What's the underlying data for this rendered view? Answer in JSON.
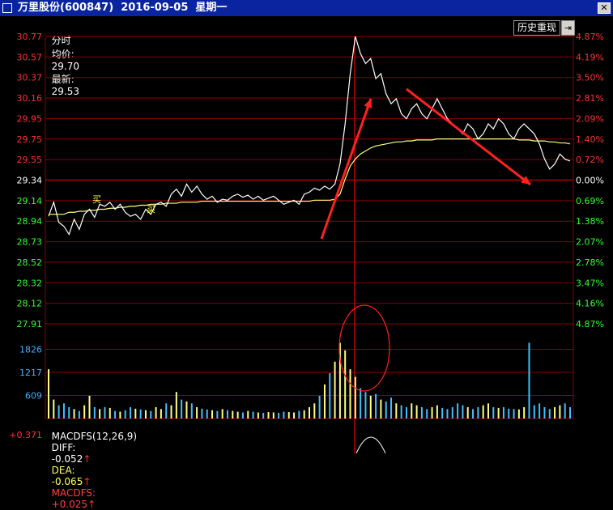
{
  "window": {
    "title": "万里股份(600847)  2016-09-05  星期一",
    "close_icon": "close-icon"
  },
  "info": {
    "mode_label": "分时",
    "avg_label": "均价:",
    "avg_value": "29.70",
    "last_label": "最新:",
    "last_value": "29.53"
  },
  "history_button": "历史重现",
  "macd": {
    "title": "MACDFS(12,26,9)",
    "diff_label": "DIFF:",
    "diff_value": "-0.052",
    "dea_label": "DEA:",
    "dea_value": "-0.065",
    "macdfs_label": "MACDFS:",
    "macdfs_value": "+0.025",
    "top_value": "+0.371"
  },
  "colors": {
    "grid": "#8b0000",
    "price_line": "#ffffff",
    "avg_line": "#ffff80",
    "up": "#ff3030",
    "down": "#30ff30",
    "volume_label": "#40b0ff",
    "annotation": "#ff2020"
  },
  "chart_data": {
    "type": "line",
    "prev_close": 29.34,
    "price_ticks": [
      "30.77",
      "30.57",
      "30.37",
      "30.16",
      "29.95",
      "29.75",
      "29.55",
      "29.34",
      "29.14",
      "28.94",
      "28.73",
      "28.52",
      "28.32",
      "28.12",
      "27.91"
    ],
    "pct_ticks": [
      "4.87%",
      "4.19%",
      "3.50%",
      "2.81%",
      "2.09%",
      "1.40%",
      "0.72%",
      "0.00%",
      "0.69%",
      "1.38%",
      "2.07%",
      "2.78%",
      "3.47%",
      "4.16%",
      "4.87%"
    ],
    "volume_ticks": [
      "1826",
      "1217",
      "609"
    ],
    "ylim": [
      27.91,
      30.77
    ],
    "markers": [
      "买",
      "买"
    ],
    "price": [
      28.98,
      29.12,
      28.92,
      28.88,
      28.8,
      28.95,
      28.85,
      29.0,
      29.05,
      28.97,
      29.1,
      29.08,
      29.12,
      29.05,
      29.1,
      29.02,
      28.98,
      29.0,
      28.95,
      29.05,
      29.0,
      29.1,
      29.12,
      29.08,
      29.2,
      29.25,
      29.18,
      29.3,
      29.22,
      29.28,
      29.2,
      29.15,
      29.18,
      29.12,
      29.15,
      29.14,
      29.18,
      29.2,
      29.17,
      29.19,
      29.15,
      29.18,
      29.14,
      29.16,
      29.18,
      29.14,
      29.1,
      29.12,
      29.14,
      29.1,
      29.2,
      29.22,
      29.26,
      29.24,
      29.28,
      29.25,
      29.3,
      29.5,
      29.9,
      30.4,
      30.77,
      30.6,
      30.5,
      30.55,
      30.35,
      30.4,
      30.2,
      30.1,
      30.15,
      30.0,
      29.95,
      30.05,
      30.1,
      30.0,
      29.95,
      30.05,
      30.15,
      30.05,
      29.95,
      29.9,
      29.85,
      29.8,
      29.9,
      29.85,
      29.75,
      29.8,
      29.9,
      29.85,
      29.95,
      29.9,
      29.8,
      29.75,
      29.85,
      29.9,
      29.85,
      29.8,
      29.7,
      29.55,
      29.45,
      29.5,
      29.6,
      29.55,
      29.53
    ],
    "average": [
      29.0,
      29.0,
      29.0,
      29.0,
      29.02,
      29.02,
      29.03,
      29.03,
      29.04,
      29.04,
      29.05,
      29.05,
      29.06,
      29.06,
      29.07,
      29.07,
      29.08,
      29.08,
      29.09,
      29.09,
      29.1,
      29.1,
      29.1,
      29.11,
      29.11,
      29.11,
      29.12,
      29.12,
      29.12,
      29.12,
      29.13,
      29.13,
      29.13,
      29.13,
      29.13,
      29.13,
      29.13,
      29.13,
      29.13,
      29.13,
      29.13,
      29.13,
      29.13,
      29.13,
      29.13,
      29.13,
      29.13,
      29.13,
      29.13,
      29.13,
      29.13,
      29.13,
      29.14,
      29.14,
      29.14,
      29.14,
      29.15,
      29.2,
      29.35,
      29.48,
      29.55,
      29.6,
      29.63,
      29.66,
      29.68,
      29.69,
      29.7,
      29.71,
      29.72,
      29.72,
      29.73,
      29.73,
      29.74,
      29.74,
      29.74,
      29.74,
      29.75,
      29.75,
      29.75,
      29.75,
      29.75,
      29.75,
      29.75,
      29.75,
      29.75,
      29.75,
      29.75,
      29.75,
      29.75,
      29.75,
      29.75,
      29.75,
      29.74,
      29.74,
      29.74,
      29.73,
      29.73,
      29.73,
      29.72,
      29.72,
      29.71,
      29.71,
      29.7
    ],
    "volume": [
      1300,
      500,
      350,
      400,
      300,
      250,
      200,
      350,
      600,
      300,
      250,
      300,
      280,
      200,
      180,
      220,
      300,
      260,
      240,
      220,
      200,
      300,
      250,
      400,
      350,
      700,
      500,
      450,
      400,
      300,
      260,
      240,
      220,
      200,
      250,
      220,
      200,
      180,
      160,
      200,
      180,
      160,
      150,
      170,
      160,
      150,
      180,
      170,
      160,
      200,
      220,
      300,
      400,
      600,
      900,
      1200,
      1500,
      2000,
      1800,
      1300,
      1100,
      800,
      700,
      600,
      650,
      500,
      450,
      550,
      400,
      350,
      300,
      400,
      350,
      300,
      250,
      300,
      350,
      280,
      250,
      300,
      400,
      350,
      300,
      250,
      300,
      350,
      400,
      300,
      280,
      300,
      260,
      250,
      240,
      300,
      2000,
      350,
      400,
      300,
      250,
      300,
      350,
      400,
      300
    ],
    "xlabel": "",
    "ylabel": ""
  }
}
